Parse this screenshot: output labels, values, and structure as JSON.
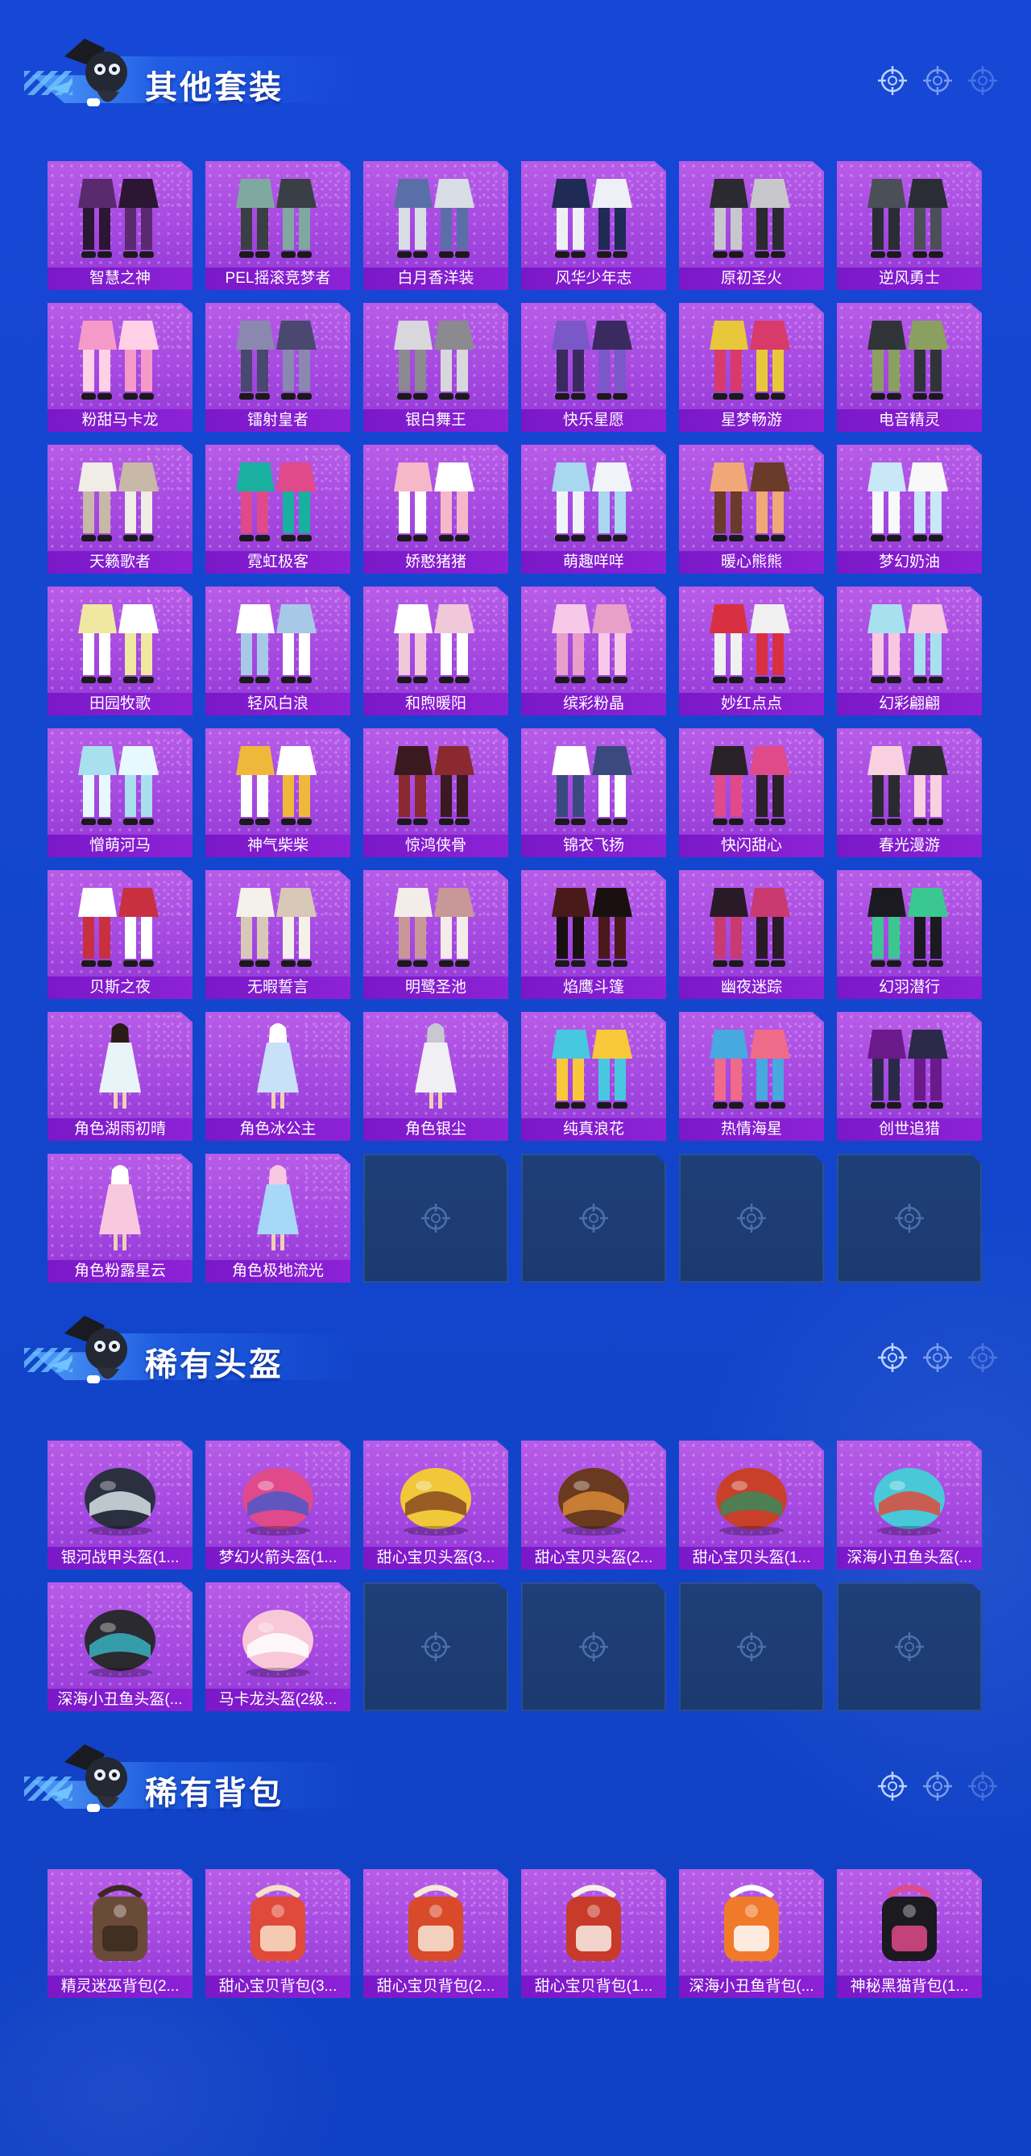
{
  "sections": [
    {
      "title": "其他套装",
      "items": [
        {
          "label": "智慧之神",
          "icon": "outfit-icon",
          "palette": [
            "#5a2a6e",
            "#2b1633"
          ]
        },
        {
          "label": "PEL摇滚竞梦者",
          "icon": "outfit-icon",
          "palette": [
            "#7fa8a0",
            "#3a3f45"
          ]
        },
        {
          "label": "白月香洋装",
          "icon": "outfit-icon",
          "palette": [
            "#5a6fa8",
            "#d8dde6"
          ]
        },
        {
          "label": "风华少年志",
          "icon": "outfit-icon",
          "palette": [
            "#1f2a55",
            "#eef0f5"
          ]
        },
        {
          "label": "原初圣火",
          "icon": "outfit-icon",
          "palette": [
            "#2a2a30",
            "#c8c8cc"
          ]
        },
        {
          "label": "逆风勇士",
          "icon": "outfit-icon",
          "palette": [
            "#4a4f58",
            "#2a2d33"
          ]
        },
        {
          "label": "粉甜马卡龙",
          "icon": "outfit-icon",
          "palette": [
            "#f59ac8",
            "#ffd0e6"
          ]
        },
        {
          "label": "镭射皇者",
          "icon": "outfit-icon",
          "palette": [
            "#8a88b0",
            "#4a4870"
          ]
        },
        {
          "label": "银白舞王",
          "icon": "outfit-icon",
          "palette": [
            "#d8d8dc",
            "#8a8a90"
          ]
        },
        {
          "label": "快乐星愿",
          "icon": "outfit-icon",
          "palette": [
            "#7a58c8",
            "#3a2a60"
          ]
        },
        {
          "label": "星梦畅游",
          "icon": "outfit-icon",
          "palette": [
            "#e8c83a",
            "#d83a6a"
          ]
        },
        {
          "label": "电音精灵",
          "icon": "outfit-icon",
          "palette": [
            "#303438",
            "#8aa060"
          ]
        },
        {
          "label": "天籁歌者",
          "icon": "outfit-icon",
          "palette": [
            "#f0ece6",
            "#c8b8a8"
          ]
        },
        {
          "label": "霓虹极客",
          "icon": "outfit-icon",
          "palette": [
            "#1ab0a0",
            "#e04a8a"
          ]
        },
        {
          "label": "娇憨猪猪",
          "icon": "outfit-icon",
          "palette": [
            "#f6b8c8",
            "#ffffff"
          ]
        },
        {
          "label": "萌趣咩咩",
          "icon": "outfit-icon",
          "palette": [
            "#a8d8f0",
            "#f0f4f8"
          ]
        },
        {
          "label": "暖心熊熊",
          "icon": "outfit-icon",
          "palette": [
            "#f0a878",
            "#6a3a2a"
          ]
        },
        {
          "label": "梦幻奶油",
          "icon": "outfit-icon",
          "palette": [
            "#c8e8f8",
            "#f8f8f8"
          ]
        },
        {
          "label": "田园牧歌",
          "icon": "outfit-icon",
          "palette": [
            "#f0e8a0",
            "#ffffff"
          ]
        },
        {
          "label": "轻风白浪",
          "icon": "outfit-icon",
          "palette": [
            "#ffffff",
            "#a8c8e8"
          ]
        },
        {
          "label": "和煦暖阳",
          "icon": "outfit-icon",
          "palette": [
            "#ffffff",
            "#f0c8d8"
          ]
        },
        {
          "label": "缤彩粉晶",
          "icon": "outfit-icon",
          "palette": [
            "#f8c8e8",
            "#e8a0c8"
          ]
        },
        {
          "label": "妙红点点",
          "icon": "outfit-icon",
          "palette": [
            "#d83040",
            "#f0f0f0"
          ]
        },
        {
          "label": "幻彩翩翩",
          "icon": "outfit-icon",
          "palette": [
            "#a8e0f0",
            "#f8c8e0"
          ]
        },
        {
          "label": "憎萌河马",
          "icon": "outfit-icon",
          "palette": [
            "#a8e0f0",
            "#e8f8ff"
          ]
        },
        {
          "label": "神气柴柴",
          "icon": "outfit-icon",
          "palette": [
            "#f0b83a",
            "#ffffff"
          ]
        },
        {
          "label": "惊鸿侠骨",
          "icon": "outfit-icon",
          "palette": [
            "#3a1a20",
            "#8a2a30"
          ]
        },
        {
          "label": "锦衣飞扬",
          "icon": "outfit-icon",
          "palette": [
            "#ffffff",
            "#3a4a80"
          ]
        },
        {
          "label": "快闪甜心",
          "icon": "outfit-icon",
          "palette": [
            "#2a2028",
            "#e04a8a"
          ]
        },
        {
          "label": "春光漫游",
          "icon": "outfit-icon",
          "palette": [
            "#f8d0e0",
            "#2a2a30"
          ]
        },
        {
          "label": "贝斯之夜",
          "icon": "outfit-icon",
          "palette": [
            "#ffffff",
            "#c83040"
          ]
        },
        {
          "label": "无暇誓言",
          "icon": "outfit-icon",
          "palette": [
            "#f4f0ea",
            "#d8c8b8"
          ]
        },
        {
          "label": "明鹭圣池",
          "icon": "outfit-icon",
          "palette": [
            "#f4ece8",
            "#c89898"
          ]
        },
        {
          "label": "焰鹰斗篷",
          "icon": "outfit-icon",
          "palette": [
            "#4a1a1a",
            "#1a1012"
          ]
        },
        {
          "label": "幽夜迷踪",
          "icon": "outfit-icon",
          "palette": [
            "#2a1a28",
            "#c83a70"
          ]
        },
        {
          "label": "幻羽潜行",
          "icon": "outfit-icon",
          "palette": [
            "#1a1a20",
            "#3ac890"
          ]
        },
        {
          "label": "角色湖雨初晴",
          "icon": "figure-icon",
          "palette": [
            "#e8f4f8",
            "#2a1a18"
          ]
        },
        {
          "label": "角色冰公主",
          "icon": "figure-icon",
          "palette": [
            "#c8e0f8",
            "#ffffff"
          ]
        },
        {
          "label": "角色银尘",
          "icon": "figure-icon",
          "palette": [
            "#f0f0f4",
            "#c8c8d0"
          ]
        },
        {
          "label": "纯真浪花",
          "icon": "outfit-icon",
          "palette": [
            "#48c8e0",
            "#f8c83a"
          ]
        },
        {
          "label": "热情海星",
          "icon": "outfit-icon",
          "palette": [
            "#48a8e0",
            "#f06a8a"
          ]
        },
        {
          "label": "创世追猎",
          "icon": "outfit-icon",
          "palette": [
            "#6a1a8a",
            "#2a2a48"
          ]
        },
        {
          "label": "角色粉露星云",
          "icon": "figure-icon",
          "palette": [
            "#f8c8e0",
            "#ffffff"
          ]
        },
        {
          "label": "角色极地流光",
          "icon": "figure-icon",
          "palette": [
            "#a8d8f8",
            "#f8c8e0"
          ]
        }
      ],
      "empty_slots": 4
    },
    {
      "title": "稀有头盔",
      "items": [
        {
          "label": "银河战甲头盔(1...",
          "icon": "helmet-icon",
          "palette": [
            "#2a3040",
            "#d8e0e8"
          ]
        },
        {
          "label": "梦幻火箭头盔(1...",
          "icon": "helmet-icon",
          "palette": [
            "#e04a8a",
            "#4a58c8"
          ]
        },
        {
          "label": "甜心宝贝头盔(3...",
          "icon": "helmet-icon",
          "palette": [
            "#f0c83a",
            "#8a4a20"
          ]
        },
        {
          "label": "甜心宝贝头盔(2...",
          "icon": "helmet-icon",
          "palette": [
            "#6a3a20",
            "#d88a3a"
          ]
        },
        {
          "label": "甜心宝贝头盔(1...",
          "icon": "helmet-icon",
          "palette": [
            "#c8402a",
            "#3a8a5a"
          ]
        },
        {
          "label": "深海小丑鱼头盔(...",
          "icon": "helmet-icon",
          "palette": [
            "#48c8d8",
            "#e04a3a"
          ]
        },
        {
          "label": "深海小丑鱼头盔(...",
          "icon": "helmet-icon",
          "palette": [
            "#2a2a30",
            "#3ab0c0"
          ]
        },
        {
          "label": "马卡龙头盔(2级...",
          "icon": "helmet-icon",
          "palette": [
            "#f8c8d8",
            "#ffffff"
          ]
        }
      ],
      "empty_slots": 4
    },
    {
      "title": "稀有背包",
      "items": [
        {
          "label": "精灵迷巫背包(2...",
          "icon": "backpack-icon",
          "palette": [
            "#6a4a38",
            "#3a2a20"
          ]
        },
        {
          "label": "甜心宝贝背包(3...",
          "icon": "backpack-icon",
          "palette": [
            "#e04a3a",
            "#f8e0c8"
          ]
        },
        {
          "label": "甜心宝贝背包(2...",
          "icon": "backpack-icon",
          "palette": [
            "#d84a2a",
            "#f8e8d8"
          ]
        },
        {
          "label": "甜心宝贝背包(1...",
          "icon": "backpack-icon",
          "palette": [
            "#c83a2a",
            "#f8f0e8"
          ]
        },
        {
          "label": "深海小丑鱼背包(...",
          "icon": "backpack-icon",
          "palette": [
            "#f07a2a",
            "#ffffff"
          ]
        },
        {
          "label": "神秘黑猫背包(1...",
          "icon": "backpack-icon",
          "palette": [
            "#1a1a20",
            "#e04a8a"
          ]
        }
      ],
      "empty_slots": 0
    }
  ],
  "colors": {
    "background": "#1446cf",
    "card": "#a448e0",
    "label_bar": "#8020cc",
    "empty_card": "#1e3e76"
  }
}
